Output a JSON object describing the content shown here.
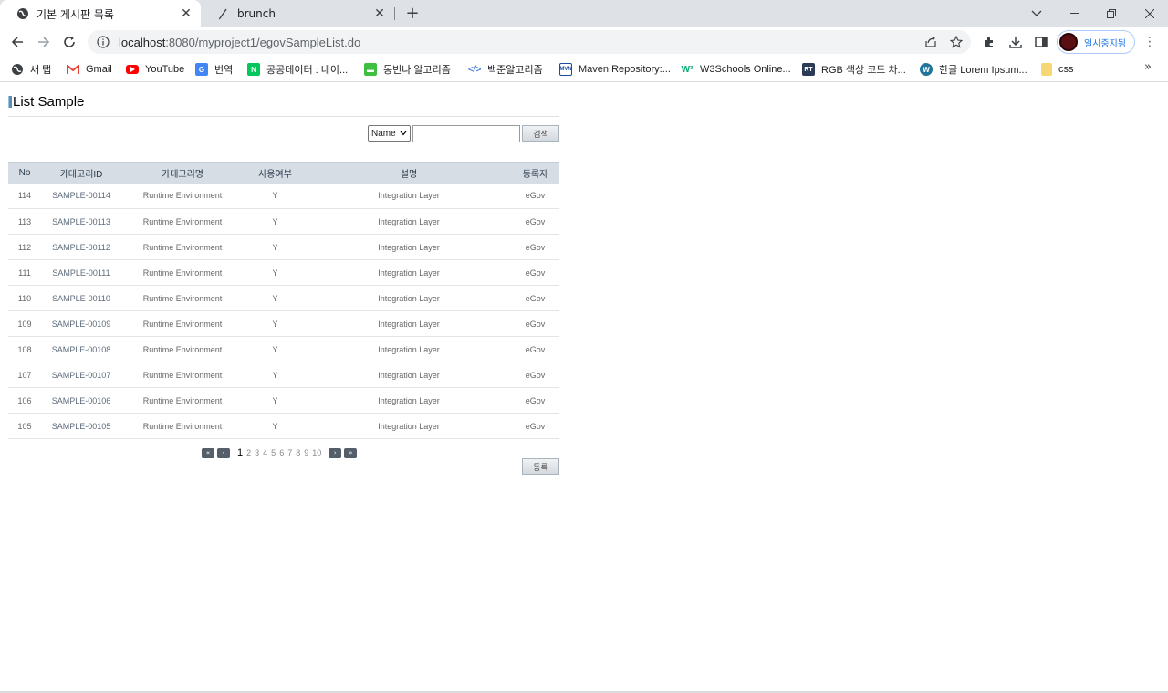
{
  "browser": {
    "tabs": [
      {
        "title": "기본 게시판 목록",
        "active": true
      },
      {
        "title": "brunch",
        "active": false
      }
    ],
    "url_host": "localhost",
    "url_rest": ":8080/myproject1/egovSampleList.do",
    "profile_label": "일시중지됨"
  },
  "bookmarks": [
    {
      "label": "새 탭",
      "icon": "globe-icon",
      "color": "#3c4043"
    },
    {
      "label": "Gmail",
      "icon": "gmail-icon",
      "color": "#ea4335"
    },
    {
      "label": "YouTube",
      "icon": "youtube-icon",
      "color": "#ff0000"
    },
    {
      "label": "번역",
      "icon": "translate-icon",
      "color": "#4285f4"
    },
    {
      "label": "공공데이터 : 네이...",
      "icon": "naver-icon",
      "color": "#03c75a"
    },
    {
      "label": "동빈나 알고리즘",
      "icon": "chat-icon",
      "color": "#3fbf3f"
    },
    {
      "label": "백준알고리즘",
      "icon": "code-icon",
      "color": "#4a7fd4"
    },
    {
      "label": "Maven Repository:...",
      "icon": "maven-icon",
      "color": "#1b4b9b"
    },
    {
      "label": "W3Schools Online...",
      "icon": "w3-icon",
      "color": "#04aa6d"
    },
    {
      "label": "RGB 색상 코드 차...",
      "icon": "rgb-icon",
      "color": "#2b3a55"
    },
    {
      "label": "한글 Lorem Ipsum...",
      "icon": "wordpress-icon",
      "color": "#21759b"
    },
    {
      "label": "css",
      "icon": "folder-icon",
      "color": "#f7d774"
    }
  ],
  "page": {
    "title": "List Sample",
    "search_option": "Name",
    "search_value": "",
    "search_button": "검색",
    "register_button": "등록"
  },
  "table": {
    "headers": [
      "No",
      "카테고리ID",
      "카테고리명",
      "사용여부",
      "설명",
      "등록자"
    ],
    "rows": [
      [
        "114",
        "SAMPLE-00114",
        "Runtime Environment",
        "Y",
        "Integration Layer",
        "eGov"
      ],
      [
        "113",
        "SAMPLE-00113",
        "Runtime Environment",
        "Y",
        "Integration Layer",
        "eGov"
      ],
      [
        "112",
        "SAMPLE-00112",
        "Runtime Environment",
        "Y",
        "Integration Layer",
        "eGov"
      ],
      [
        "111",
        "SAMPLE-00111",
        "Runtime Environment",
        "Y",
        "Integration Layer",
        "eGov"
      ],
      [
        "110",
        "SAMPLE-00110",
        "Runtime Environment",
        "Y",
        "Integration Layer",
        "eGov"
      ],
      [
        "109",
        "SAMPLE-00109",
        "Runtime Environment",
        "Y",
        "Integration Layer",
        "eGov"
      ],
      [
        "108",
        "SAMPLE-00108",
        "Runtime Environment",
        "Y",
        "Integration Layer",
        "eGov"
      ],
      [
        "107",
        "SAMPLE-00107",
        "Runtime Environment",
        "Y",
        "Integration Layer",
        "eGov"
      ],
      [
        "106",
        "SAMPLE-00106",
        "Runtime Environment",
        "Y",
        "Integration Layer",
        "eGov"
      ],
      [
        "105",
        "SAMPLE-00105",
        "Runtime Environment",
        "Y",
        "Integration Layer",
        "eGov"
      ]
    ]
  },
  "pagination": {
    "pages": [
      "1",
      "2",
      "3",
      "4",
      "5",
      "6",
      "7",
      "8",
      "9",
      "10"
    ],
    "current": "1"
  }
}
